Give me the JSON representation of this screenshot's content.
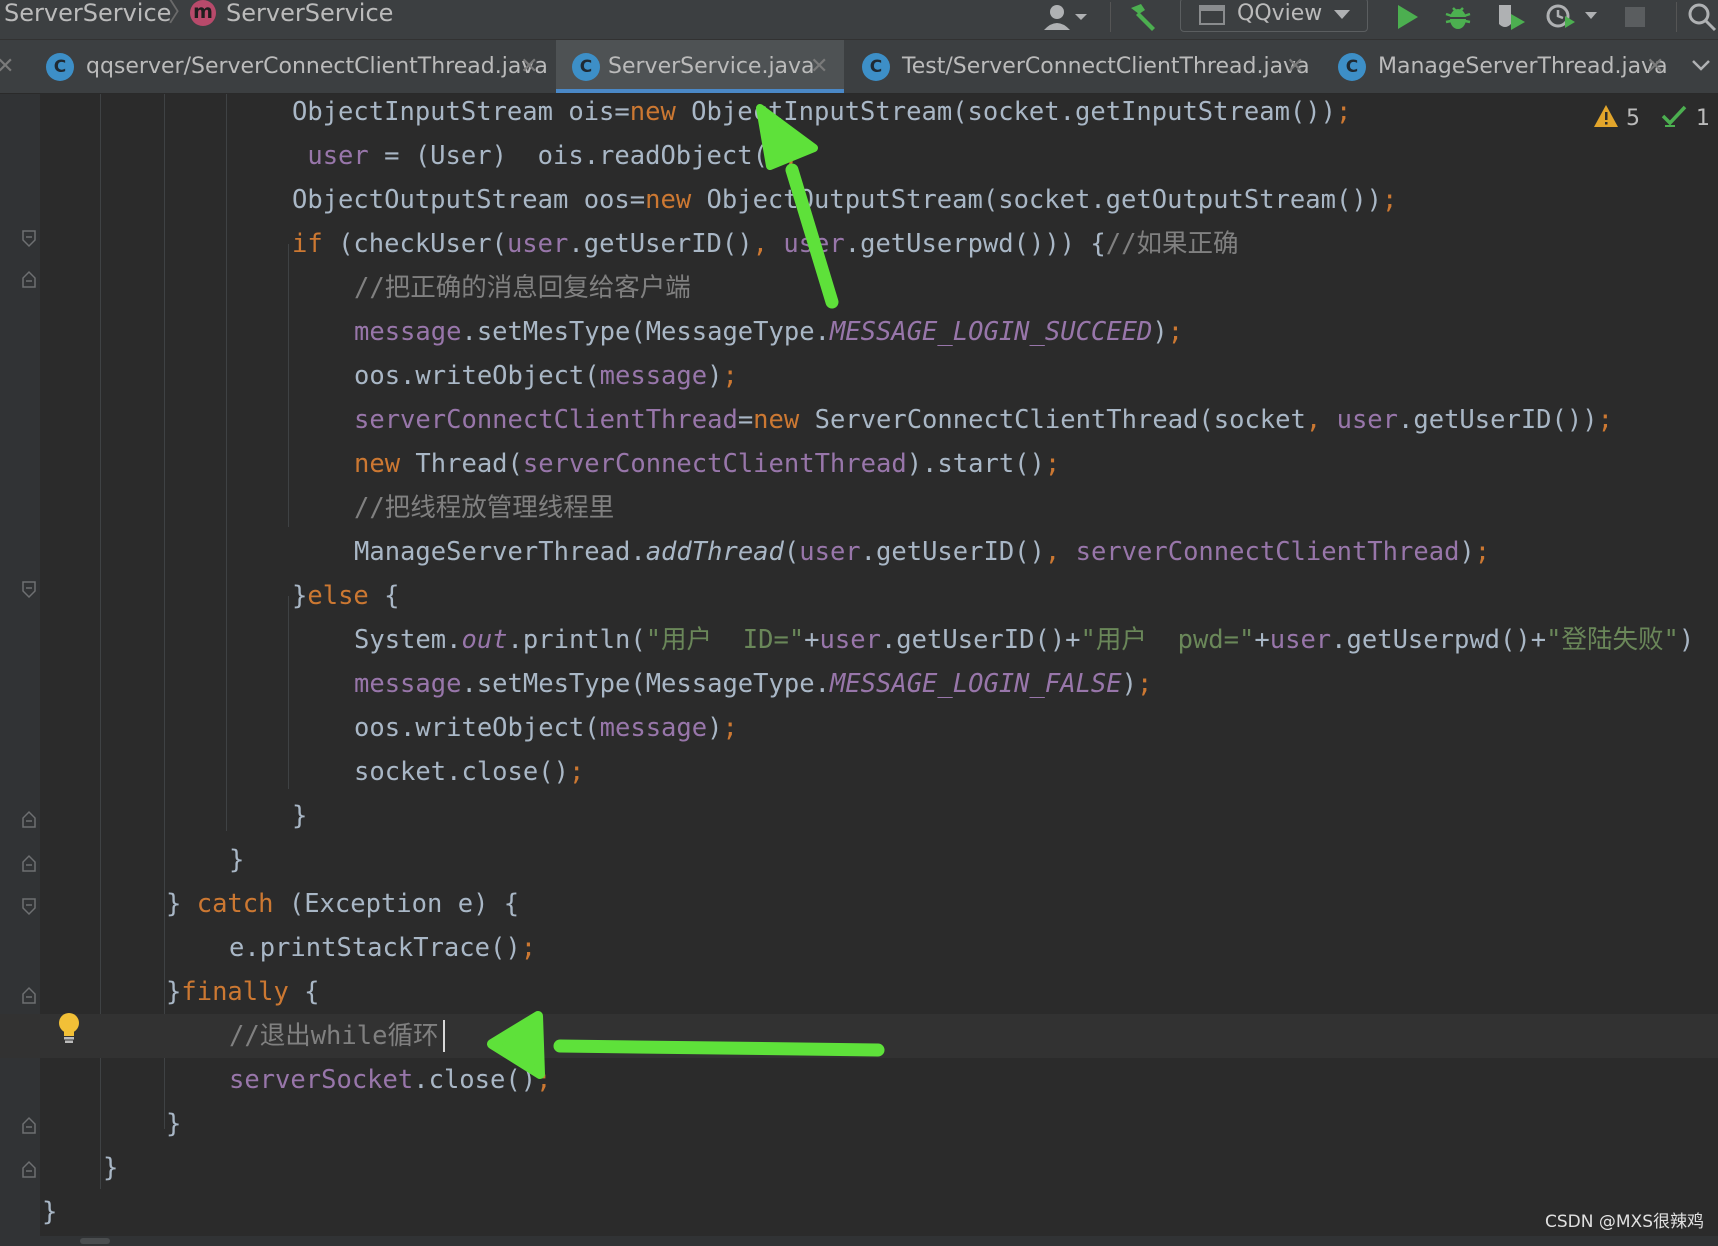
{
  "navbar": {
    "breadcrumb_project": "ServerService",
    "breadcrumb_separator": "〉",
    "breadcrumb_method_badge": "m",
    "breadcrumb_method": "ServerService",
    "run_configuration": "QQview",
    "icons": [
      "user-icon",
      "build-hammer-icon",
      "run-icon",
      "debug-icon",
      "coverage-icon",
      "profile-icon",
      "stop-icon",
      "search-icon"
    ],
    "colors": {
      "run": "#4caf50",
      "debug": "#4caf50",
      "method_badge": "#b84a6b"
    }
  },
  "tabs": [
    {
      "label": "qqserver/ServerConnectClientThread.java",
      "icon": "C",
      "active": false
    },
    {
      "label": "ServerService.java",
      "icon": "C",
      "active": true
    },
    {
      "label": "Test/ServerConnectClientThread.java",
      "icon": "C",
      "active": false
    },
    {
      "label": "ManageServerThread.java",
      "icon": "C",
      "active": false
    }
  ],
  "tab_close_glyph": "✕",
  "inspections": {
    "warnings": "5",
    "checks": "1"
  },
  "code": {
    "l1": {
      "a": "ObjectInputStream ois=",
      "b": "new",
      "c": " ObjectInputStream(socket.getInputStream())",
      "d": ";"
    },
    "l2": {
      "a": " user",
      "b": " = (User)  ois.readObject()",
      "c": ";"
    },
    "l3": {
      "a": "ObjectOutputStream oos=",
      "b": "new",
      "c": " ObjectOutputStream(socket.getOutputStream())",
      "d": ";"
    },
    "l4": {
      "a": "if",
      "b": " (checkUser(",
      "c": "user",
      "d": ".getUserID()",
      "e": ",",
      "f": " ",
      "g": "user",
      "h": ".getUserpwd())) {",
      "i": "//如果正确"
    },
    "l5": {
      "a": "//把正确的消息回复给客户端"
    },
    "l6": {
      "a": "message",
      "b": ".setMesType(MessageType.",
      "c": "MESSAGE_LOGIN_SUCCEED",
      "d": ")",
      "e": ";"
    },
    "l7": {
      "a": "oos.writeObject(",
      "b": "message",
      "c": ")",
      "d": ";"
    },
    "l8": {
      "a": "serverConnectClientThread",
      "b": "=",
      "c": "new",
      "d": " ServerConnectClientThread(socket",
      "e": ",",
      "f": " ",
      "g": "user",
      "h": ".getUserID())",
      "i": ";"
    },
    "l9": {
      "a": "new",
      "b": " Thread(",
      "c": "serverConnectClientThread",
      "d": ").start()",
      "e": ";"
    },
    "l10": {
      "a": "//把线程放管理线程里"
    },
    "l11": {
      "a": "ManageServerThread.",
      "b": "addThread",
      "c": "(",
      "d": "user",
      "e": ".getUserID()",
      "f": ",",
      "g": " ",
      "h": "serverConnectClientThread",
      "i": ")",
      "j": ";"
    },
    "l12": {
      "a": "}",
      "b": "else",
      "c": " {"
    },
    "l13": {
      "a": "System.",
      "b": "out",
      "c": ".println(",
      "d": "\"用户  ID=\"",
      "e": "+",
      "f": "user",
      "g": ".getUserID()+",
      "h": "\"用户  pwd=\"",
      "i": "+",
      "j": "user",
      "k": ".getUserpwd()+",
      "l": "\"登陆失败\"",
      "m": ")"
    },
    "l14": {
      "a": "message",
      "b": ".setMesType(MessageType.",
      "c": "MESSAGE_LOGIN_FALSE",
      "d": ")",
      "e": ";"
    },
    "l15": {
      "a": "oos.writeObject(",
      "b": "message",
      "c": ")",
      "d": ";"
    },
    "l16": {
      "a": "socket.close()",
      "b": ";"
    },
    "l17": {
      "a": "}"
    },
    "l18": {
      "a": "}"
    },
    "l19": {
      "a": "} ",
      "b": "catch",
      "c": " (Exception e) {"
    },
    "l20": {
      "a": "e.printStackTrace()",
      "b": ";"
    },
    "l21": {
      "a": "}",
      "b": "finally",
      "c": " {"
    },
    "l22": {
      "a": "//退出while循环"
    },
    "l23": {
      "a": "serverSocket",
      "b": ".close()",
      "c": ";"
    },
    "l24": {
      "a": "}"
    },
    "l25": {
      "a": "}"
    },
    "l26": {
      "a": "}"
    }
  },
  "annotations": {
    "arrow_color": "#5ee13a"
  },
  "watermark": "CSDN @MXS很辣鸡"
}
